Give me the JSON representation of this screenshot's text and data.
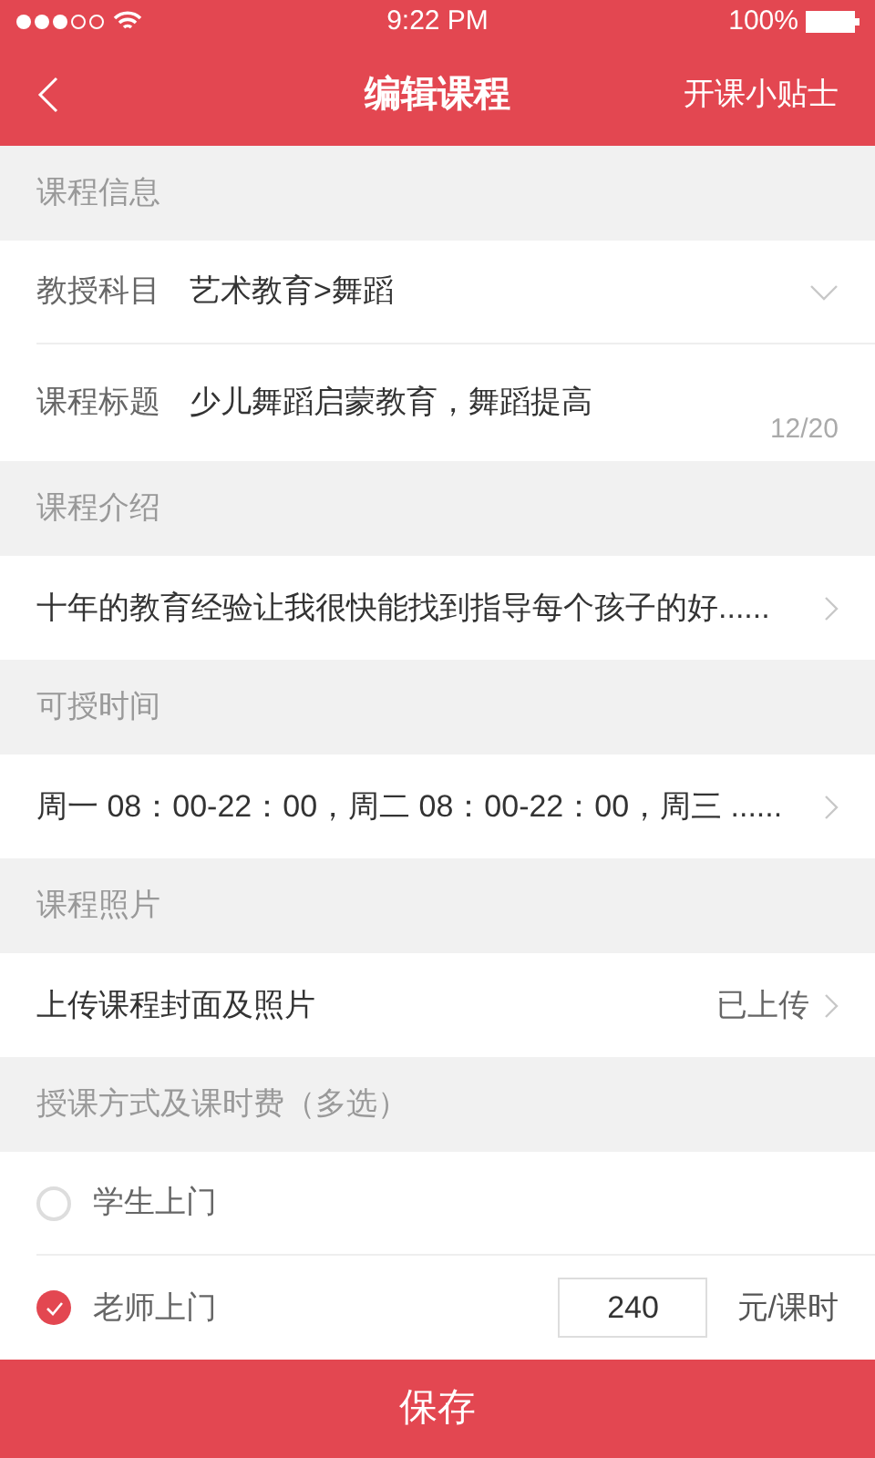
{
  "status_bar": {
    "time": "9:22 PM",
    "battery": "100%"
  },
  "nav": {
    "title": "编辑课程",
    "action": "开课小贴士"
  },
  "sections": [
    {
      "title": "课程信息",
      "rows": [
        {
          "kind": "select",
          "label": "教授科目",
          "value": "艺术教育>舞蹈"
        },
        {
          "kind": "text_input",
          "label": "课程标题",
          "value": "少儿舞蹈启蒙教育，舞蹈提高",
          "counter": "12/20"
        }
      ]
    },
    {
      "title": "课程介绍",
      "rows": [
        {
          "kind": "link",
          "value": "十年的教育经验让我很快能找到指导每个孩子的好......"
        }
      ]
    },
    {
      "title": "可授时间",
      "rows": [
        {
          "kind": "link",
          "value": "周一 08：00-22：00，周二 08：00-22：00，周三 ......"
        }
      ]
    },
    {
      "title": "课程照片",
      "rows": [
        {
          "kind": "link",
          "value": "上传课程封面及照片",
          "status": "已上传"
        }
      ]
    },
    {
      "title": "授课方式及课时费（多选）",
      "rows": [
        {
          "kind": "checkbox",
          "label": "学生上门",
          "checked": false
        },
        {
          "kind": "checkbox",
          "label": "老师上门",
          "checked": true,
          "price": "240",
          "unit": "元/课时"
        }
      ]
    }
  ],
  "save_button": "保存"
}
